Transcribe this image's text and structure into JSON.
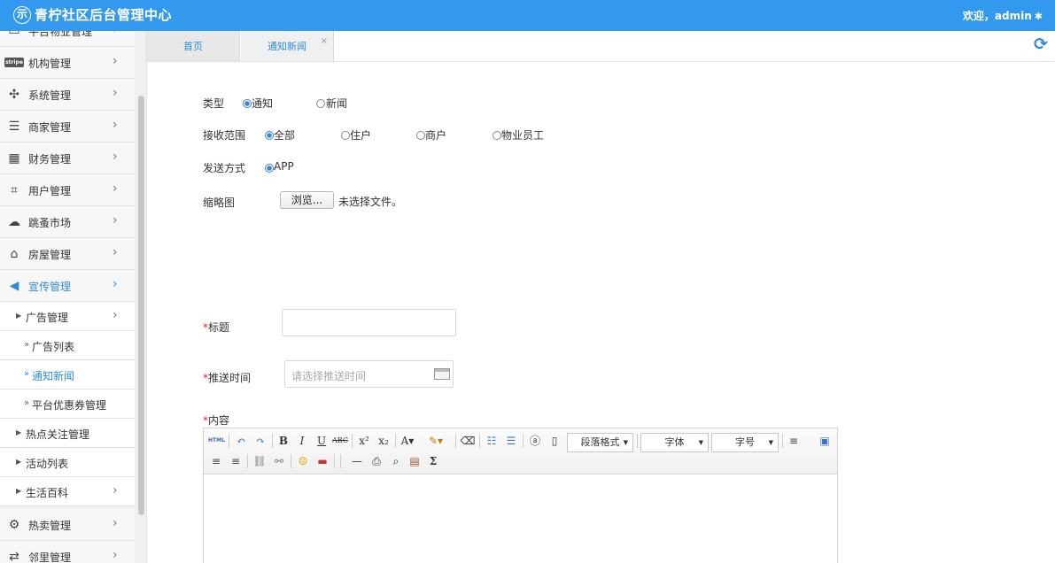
{
  "header": {
    "logo_glyph": "示",
    "title": "青柠社区后台管理中心",
    "welcome": "欢迎，admin",
    "brand_color": "#3399ee"
  },
  "sidebar": {
    "items": [
      {
        "label": "平台物业管理",
        "icon": "monitor-icon"
      },
      {
        "label": "机构管理",
        "icon": "stripe-icon",
        "badge": "stripe"
      },
      {
        "label": "系统管理",
        "icon": "pinwheel-icon"
      },
      {
        "label": "商家管理",
        "icon": "list-icon"
      },
      {
        "label": "财务管理",
        "icon": "calculator-icon"
      },
      {
        "label": "用户管理",
        "icon": "crop-icon"
      },
      {
        "label": "跳蚤市场",
        "icon": "cloud-icon"
      },
      {
        "label": "房屋管理",
        "icon": "bank-icon"
      },
      {
        "label": "宣传管理",
        "icon": "megaphone-icon",
        "active": true
      }
    ],
    "sub_items": [
      {
        "label": "广告管理",
        "has_arrow": true
      },
      {
        "label": "热点关注管理",
        "has_arrow": false
      },
      {
        "label": "活动列表",
        "has_arrow": false
      },
      {
        "label": "生活百科",
        "has_arrow": true
      }
    ],
    "ad_children": [
      {
        "label": "广告列表"
      },
      {
        "label": "通知新闻",
        "active": true
      },
      {
        "label": "平台优惠券管理"
      }
    ],
    "bottom_items": [
      {
        "label": "热卖管理",
        "icon": "gear-outline-icon"
      },
      {
        "label": "邻里管理",
        "icon": "exchange-icon"
      }
    ]
  },
  "tabs": [
    {
      "label": "首页"
    },
    {
      "label": "通知新闻",
      "closable": true
    }
  ],
  "form": {
    "type_label": "类型",
    "type_options": [
      {
        "label": "通知",
        "checked": true
      },
      {
        "label": "新闻",
        "checked": false
      }
    ],
    "scope_label": "接收范围",
    "scope_options": [
      {
        "label": "全部",
        "checked": true
      },
      {
        "label": "住户",
        "checked": false
      },
      {
        "label": "商户",
        "checked": false
      },
      {
        "label": "物业员工",
        "checked": false
      }
    ],
    "send_label": "发送方式",
    "send_options": [
      {
        "label": "APP",
        "checked": true
      }
    ],
    "thumb_label": "缩略图",
    "browse_button": "浏览...",
    "no_file_text": "未选择文件。",
    "title_label": "标题",
    "title_value": "",
    "push_time_label": "推送时间",
    "push_time_placeholder": "请选择推送时间",
    "content_label": "内容",
    "required_mark": "*"
  },
  "editor": {
    "paragraph_select": "段落格式",
    "font_select": "字体",
    "size_select": "字号"
  }
}
